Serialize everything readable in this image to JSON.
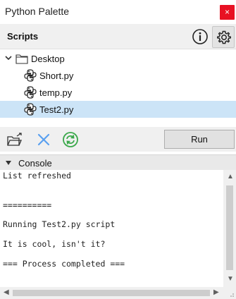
{
  "window": {
    "title": "Python Palette",
    "close_glyph": "×"
  },
  "scripts_header": {
    "label": "Scripts",
    "info_icon": "info-icon",
    "settings_icon": "gear-icon"
  },
  "tree": {
    "folder": {
      "label": "Desktop",
      "expanded": true
    },
    "files": [
      {
        "label": "Short.py",
        "selected": false
      },
      {
        "label": "temp.py",
        "selected": false
      },
      {
        "label": "Test2.py",
        "selected": true
      }
    ]
  },
  "toolbar": {
    "open_folder_icon": "open-folder-icon",
    "clear_icon": "x-icon",
    "refresh_icon": "refresh-icon",
    "run_label": "Run"
  },
  "console": {
    "label": "Console",
    "lines": [
      "List refreshed",
      "==========",
      "Running Test2.py script",
      "It is cool, isn't it?",
      "=== Process completed ==="
    ]
  },
  "colors": {
    "selection": "#cce4f7",
    "close": "#e81123",
    "clear_icon": "#5aa0f0",
    "refresh_icon": "#3aa84a"
  }
}
